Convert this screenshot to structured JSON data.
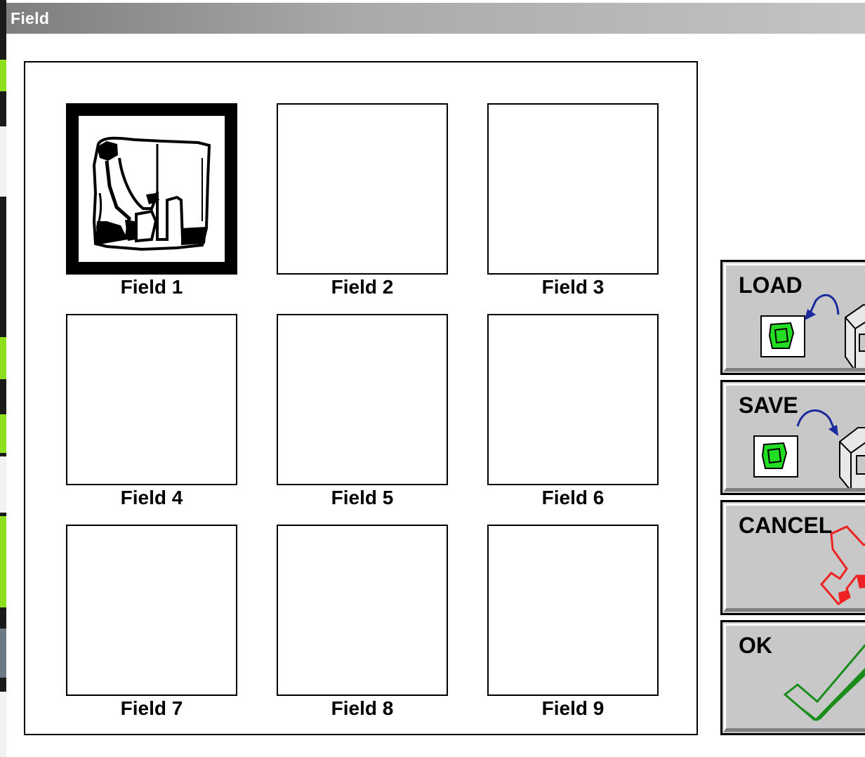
{
  "window": {
    "title": "Field"
  },
  "fields": [
    {
      "label": "Field 1",
      "selected": true,
      "has_map": true
    },
    {
      "label": "Field 2",
      "selected": false,
      "has_map": false
    },
    {
      "label": "Field 3",
      "selected": false,
      "has_map": false
    },
    {
      "label": "Field 4",
      "selected": false,
      "has_map": false
    },
    {
      "label": "Field 5",
      "selected": false,
      "has_map": false
    },
    {
      "label": "Field 6",
      "selected": false,
      "has_map": false
    },
    {
      "label": "Field 7",
      "selected": false,
      "has_map": false
    },
    {
      "label": "Field 8",
      "selected": false,
      "has_map": false
    },
    {
      "label": "Field 9",
      "selected": false,
      "has_map": false
    }
  ],
  "buttons": {
    "load": {
      "label": "LOAD",
      "icon": "load-from-disk-icon"
    },
    "save": {
      "label": "SAVE",
      "icon": "save-to-disk-icon"
    },
    "cancel": {
      "label": "CANCEL",
      "icon": "cancel-icon"
    },
    "ok": {
      "label": "OK",
      "icon": "checkmark-icon"
    }
  },
  "colors": {
    "button_face": "#c8c8c8",
    "field_green": "#22dd22",
    "arrow_blue": "#1a2a9c",
    "cancel_red": "#ee2222",
    "ok_green": "#1a8c1a"
  }
}
